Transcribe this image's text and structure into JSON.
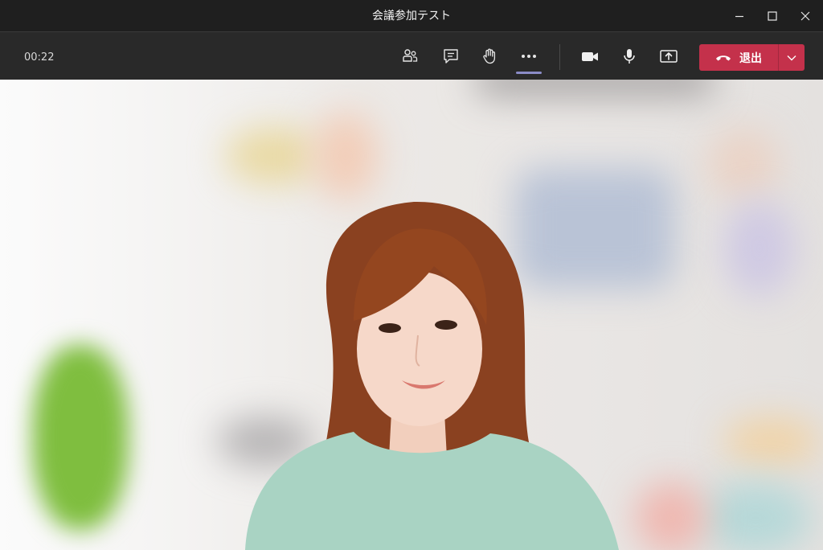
{
  "window": {
    "title": "会議参加テスト"
  },
  "toolbar": {
    "elapsed_time": "00:22",
    "leave_label": "退出"
  },
  "icons": {
    "participants": "people-icon",
    "chat": "chat-icon",
    "raise_hand": "hand-icon",
    "more": "more-actions-icon",
    "camera": "camera-icon",
    "microphone": "microphone-icon",
    "share": "share-screen-icon",
    "hang_up": "phone-hangup-icon",
    "leave_options": "chevron-down-icon"
  },
  "colors": {
    "leave_button": "#c4314b",
    "active_tab_indicator": "#8b8cc7",
    "titlebar": "#1f1f1f",
    "toolbar": "#292929"
  }
}
